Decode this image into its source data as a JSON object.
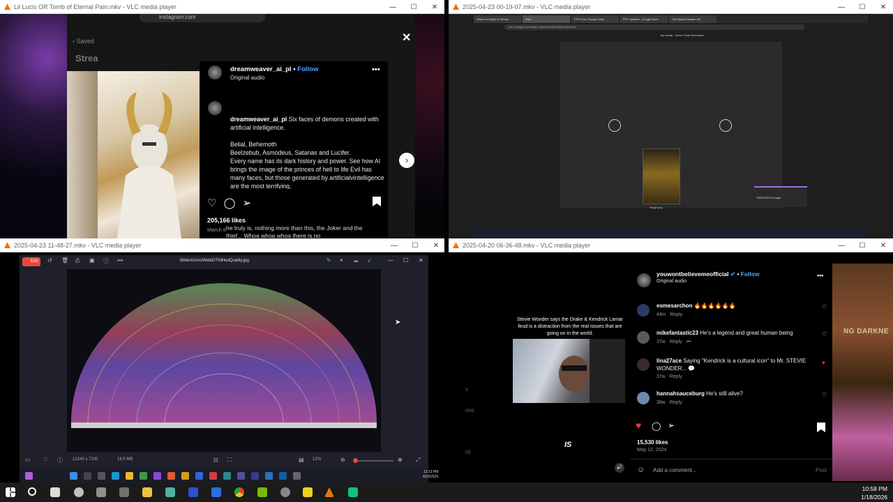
{
  "windows": [
    {
      "title": "Lil Lucis OR Tomb of Eternal Pain.mkv - VLC media player"
    },
    {
      "title": "2025-04-23 00-19-07.mkv - VLC media player"
    },
    {
      "title": "2025-04-23 11-48-27.mkv - VLC media player"
    },
    {
      "title": "2025-04-20 06-36-48.mkv - VLC media player"
    }
  ],
  "ig_post": {
    "url": "instagram.com",
    "saved": "Saved",
    "section": "Strea",
    "username": "dreamweaver_ai_pl",
    "follow": "Follow",
    "audio": "Original audio",
    "caption_user": "dreamweaver_ai_pl",
    "caption_line1": "Six faces of demons created with artificial intelligence.",
    "caption_line2": "Belial, Behemoth",
    "caption_line3": "Beelzebub, Asmodeus, Satanas and Lucifer.",
    "caption_line4": "Every name has its dark history and power. See how AI brings the image of the princes of hell to life Evil has many faces, but those generated by artificialvintelligence are the most terrifying.",
    "likes": "205,166 likes",
    "date": "March 8",
    "subtitle": "he truly is, nothing more than this, the Joker and the thief... Whoa whoa whoa there is no"
  },
  "browser": {
    "tabs": [
      "Where to Watch & Stream",
      "Sora",
      "PPTs.Tax | Google Drive",
      "PPT Updates - Google Docs",
      "The Marks Disaster list"
    ],
    "url": "sora.chatgpt.com/t/task_01js22l2xdfj4v9y5px4ebwk3xt",
    "page_title": "My media - Demo Plush Revolution",
    "poster_caption": "image.png",
    "toast": "TARTATATA Google"
  },
  "viewer": {
    "edit": "Edit",
    "filename": "BibleVizArc/WideDTINHedQuality.jpg",
    "dimensions": "12240 x 7200",
    "filesize": "18.5 MB",
    "zoom": "12%",
    "inner_clock_time": "12:13 PM",
    "inner_clock_date": "4/23/2025"
  },
  "reel": {
    "overlay_text": "Stevie Wonder says the Drake & Kendrick Lamar feud is a distraction from the real issues that are going on in the world.",
    "caption_word": "IS",
    "side_text_1": "s",
    "side_text_2": "ons",
    "side_text_3": "rd",
    "banner_text": "NG DARKNE",
    "username": "youwontbelievemeofficial",
    "follow": "Follow",
    "audio": "Original audio",
    "comments": [
      {
        "user": "esmesarchon",
        "text": "🔥🔥🔥🔥🔥🔥",
        "age": "44m",
        "reply": "Reply",
        "liked": false
      },
      {
        "user": "mikefantastic23",
        "text": "He's a legend and great human being",
        "age": "37w",
        "reply": "Reply",
        "liked": false
      },
      {
        "user": "lina27ace",
        "text": "Saying \"Kendrick is a cultural icon\" to Mr. STEVIE WONDER... 💬",
        "age": "37w",
        "reply": "Reply",
        "liked": true
      },
      {
        "user": "hannahsauceburg",
        "text": "He's still alive?",
        "age": "38w",
        "reply": "Reply",
        "liked": false
      }
    ],
    "likes": "15,530 likes",
    "date": "May 12, 2024",
    "add_comment": "Add a comment...",
    "post": "Post"
  },
  "taskbar": {
    "time": "10:58 PM",
    "date": "1/18/2026"
  }
}
